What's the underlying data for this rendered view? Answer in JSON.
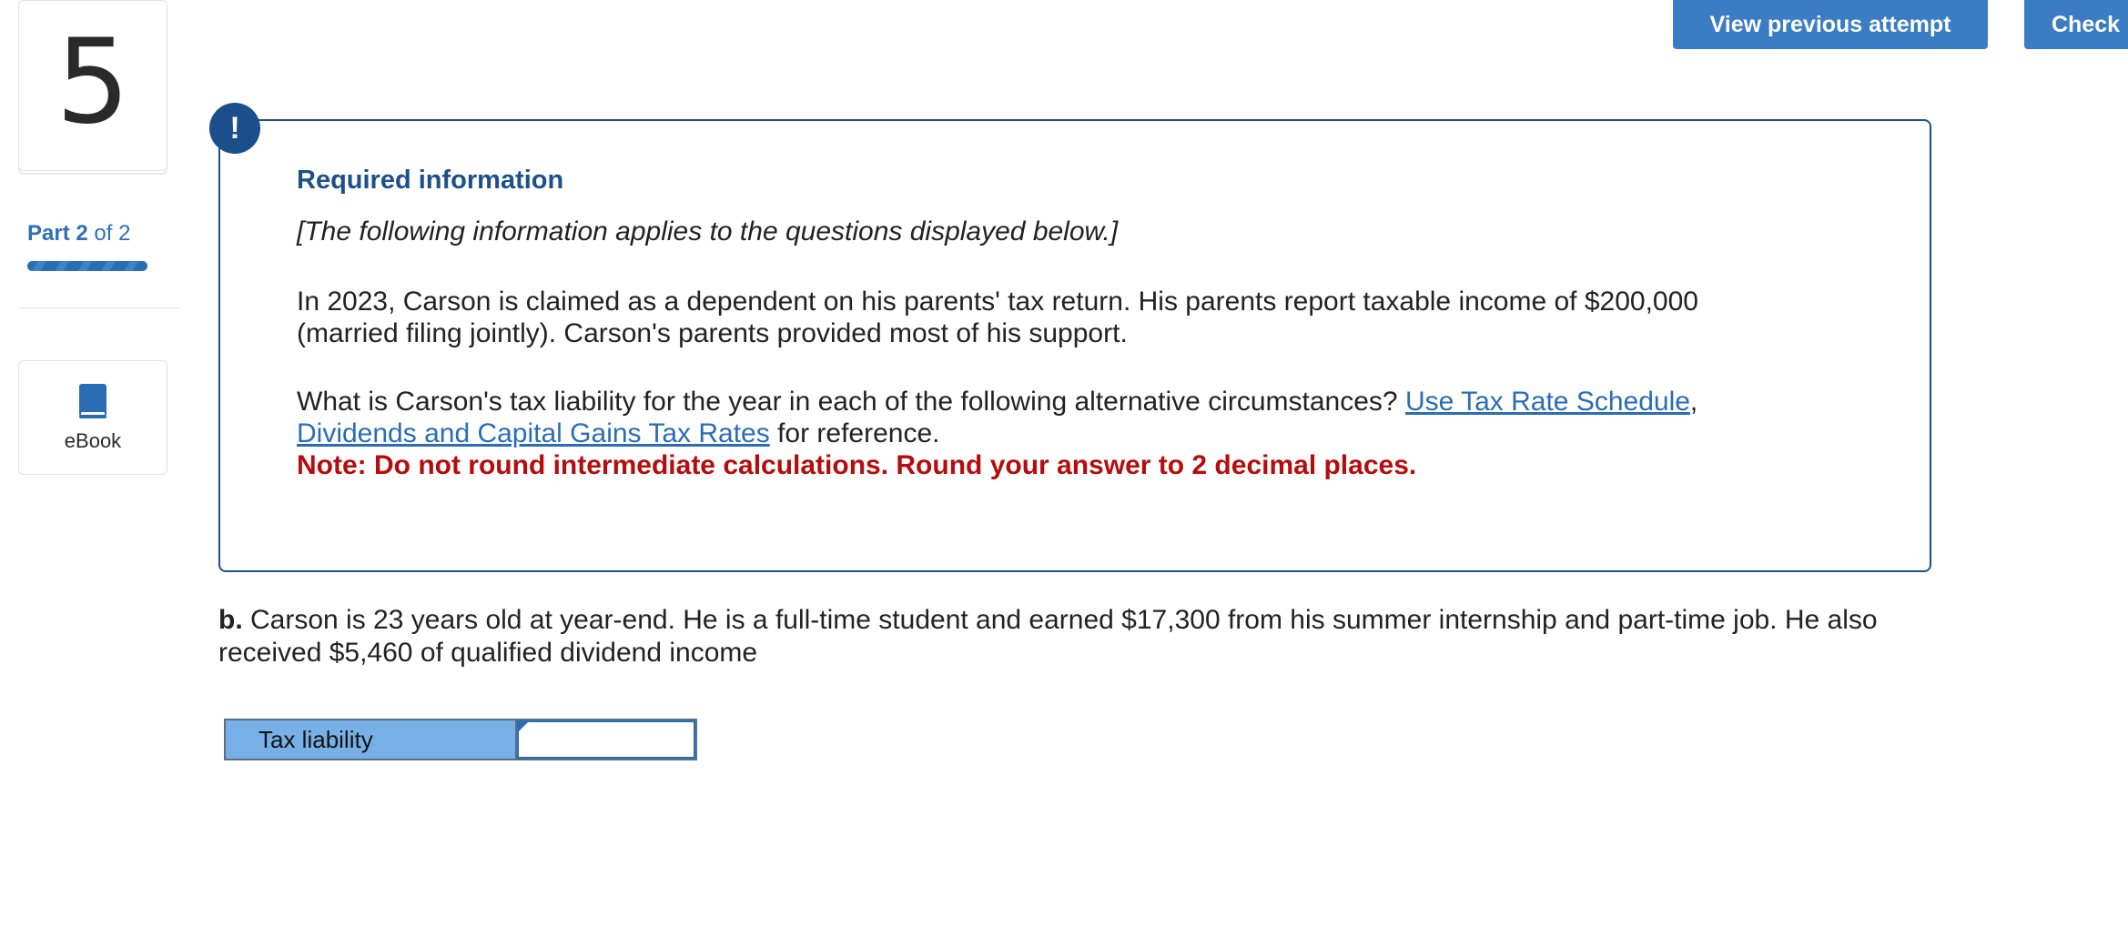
{
  "question": {
    "number": "5",
    "part_prefix": "Part",
    "part_current": "2",
    "part_suffix": "of 2",
    "progress_fraction": 1.0
  },
  "sidebar": {
    "ebook_label": "eBook",
    "ebook_icon": "book-icon"
  },
  "toolbar": {
    "view_previous_label": "View previous attempt",
    "check_label": "Check"
  },
  "info": {
    "badge": "!",
    "title": "Required information",
    "intro": "[The following information applies to the questions displayed below.]",
    "paragraph1": "In 2023, Carson is claimed as a dependent on his parents' tax return. His parents report taxable income of $200,000 (married filing jointly). Carson's parents provided most of his support.",
    "paragraph2_text": "What is Carson's tax liability for the year in each of the following alternative circumstances? ",
    "link1": "Use Tax Rate Schedule",
    "link_separator": ",",
    "link2": "Dividends and Capital Gains Tax Rates",
    "paragraph2_tail": " for reference.",
    "note": "Note: Do not round intermediate calculations. Round your answer to 2 decimal places.",
    "colors": {
      "border": "#1d4f8a",
      "note": "#b50d0d",
      "link": "#2a6db5"
    }
  },
  "question_b": {
    "label": "b.",
    "text": " Carson is 23 years old at year-end. He is a full-time student and earned $17,300 from his summer internship and part-time job. He also received $5,460 of qualified dividend income"
  },
  "answer": {
    "row_label": "Tax liability",
    "value": ""
  }
}
